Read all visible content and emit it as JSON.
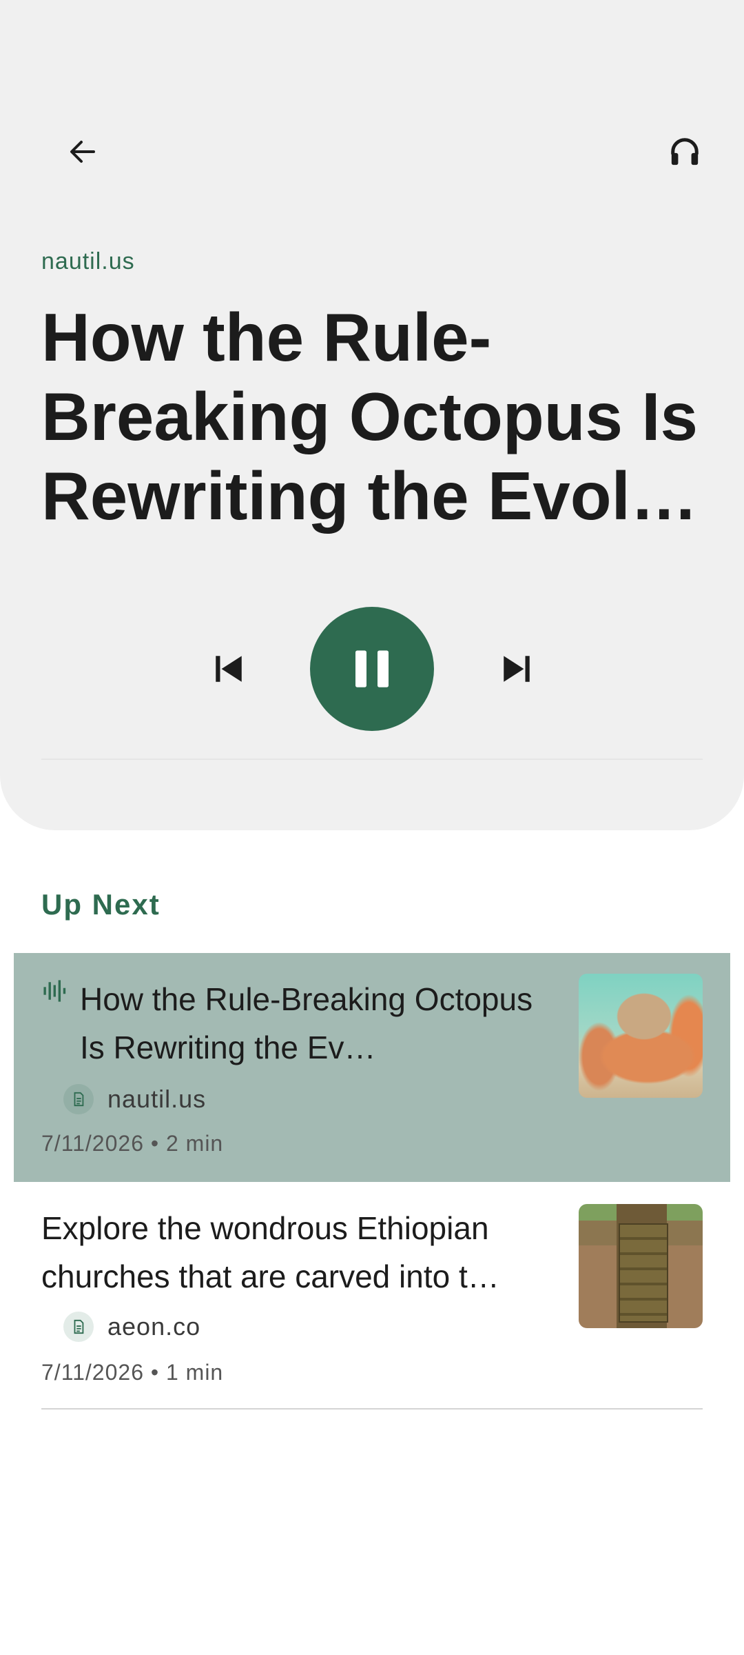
{
  "player": {
    "source": "nautil.us",
    "title": "How the Rule-Breaking Octopus Is Rewriting the Evol…",
    "icons": {
      "back": "arrow-left-icon",
      "listen": "headphones-icon",
      "previous": "skip-previous-icon",
      "play_pause": "pause-icon",
      "next": "skip-next-icon"
    },
    "accent_color": "#2e6b50",
    "is_playing": true
  },
  "up_next": {
    "heading": "Up Next",
    "items": [
      {
        "title": "How the Rule-Breaking Octopus Is Rewriting the Ev…",
        "source": "nautil.us",
        "date": "7/11/2026",
        "separator": "•",
        "duration": "2 min",
        "now_playing": true,
        "icon": "audio-wave-icon",
        "source_icon": "document-icon",
        "highlight_color": "#a3bab3"
      },
      {
        "title": "Explore the wondrous Ethiopian churches that are carved into t…",
        "source": "aeon.co",
        "date": "7/11/2026",
        "separator": "•",
        "duration": "1 min",
        "now_playing": false,
        "source_icon": "document-icon"
      }
    ]
  }
}
